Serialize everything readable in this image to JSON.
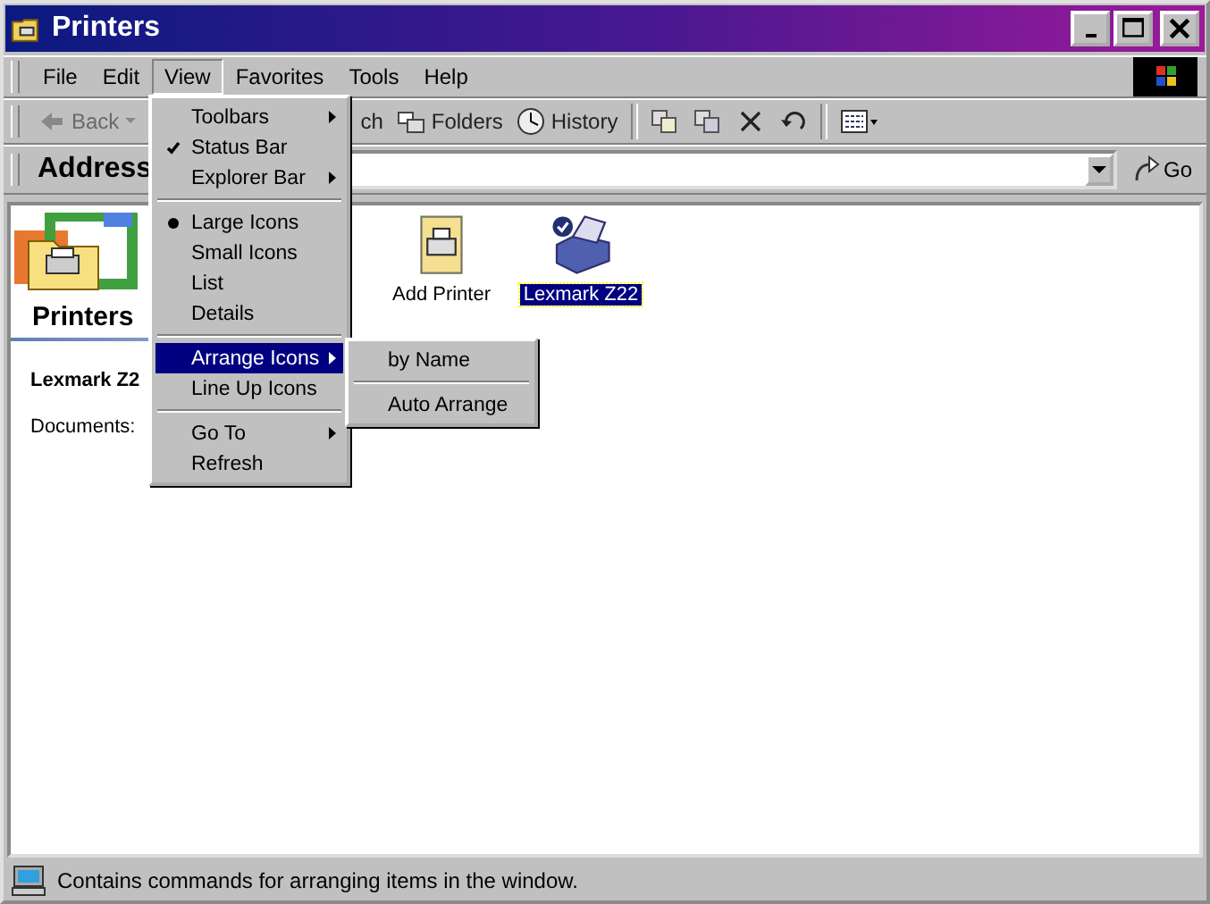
{
  "window": {
    "title": "Printers"
  },
  "menu_bar": [
    {
      "label": "File",
      "selected": false
    },
    {
      "label": "Edit",
      "selected": false
    },
    {
      "label": "View",
      "selected": true
    },
    {
      "label": "Favorites",
      "selected": false
    },
    {
      "label": "Tools",
      "selected": false
    },
    {
      "label": "Help",
      "selected": false
    }
  ],
  "toolbar": [
    {
      "kind": "back",
      "label": "Back",
      "disabled": true
    },
    {
      "kind": "search",
      "label": "ch",
      "disabled": false
    },
    {
      "kind": "folders",
      "label": "Folders",
      "disabled": false
    },
    {
      "kind": "history",
      "label": "History",
      "disabled": false
    },
    {
      "kind": "separator"
    },
    {
      "kind": "move",
      "disabled": false
    },
    {
      "kind": "copy",
      "disabled": false
    },
    {
      "kind": "delete",
      "disabled": false
    },
    {
      "kind": "undo",
      "disabled": false
    },
    {
      "kind": "separator"
    },
    {
      "kind": "views",
      "disabled": false
    }
  ],
  "address_bar": {
    "label": "Address",
    "go": "Go"
  },
  "info_panel": {
    "title": "Printers",
    "selected_name": "Lexmark Z2",
    "documents": "Documents: "
  },
  "icons": [
    {
      "kind": "add-printer",
      "label": "Add Printer",
      "selected": false
    },
    {
      "kind": "printer",
      "label": "Lexmark Z22",
      "selected": true
    }
  ],
  "view_menu": [
    {
      "kind": "command",
      "label": "Toolbars",
      "submenu": true,
      "selected": false
    },
    {
      "kind": "check",
      "label": "Status Bar",
      "checked": true,
      "submenu": false,
      "selected": false
    },
    {
      "kind": "command",
      "label": "Explorer Bar",
      "submenu": true,
      "selected": false
    },
    {
      "kind": "separator"
    },
    {
      "kind": "radio",
      "label": "Large Icons",
      "checked": true,
      "submenu": false,
      "selected": false
    },
    {
      "kind": "radio",
      "label": "Small Icons",
      "checked": false,
      "submenu": false,
      "selected": false
    },
    {
      "kind": "radio",
      "label": "List",
      "checked": false,
      "submenu": false,
      "selected": false
    },
    {
      "kind": "radio",
      "label": "Details",
      "checked": false,
      "submenu": false,
      "selected": false
    },
    {
      "kind": "separator"
    },
    {
      "kind": "command",
      "label": "Arrange Icons",
      "submenu": true,
      "selected": true
    },
    {
      "kind": "command",
      "label": "Line Up Icons",
      "submenu": false,
      "selected": false
    },
    {
      "kind": "separator"
    },
    {
      "kind": "command",
      "label": "Go To",
      "submenu": true,
      "selected": false
    },
    {
      "kind": "command",
      "label": "Refresh",
      "submenu": false,
      "selected": false
    }
  ],
  "arrange_submenu": [
    {
      "kind": "command",
      "label": "by Name",
      "selected": false
    },
    {
      "kind": "separator"
    },
    {
      "kind": "command",
      "label": "Auto Arrange",
      "selected": false
    }
  ],
  "status_bar": {
    "text": "Contains commands for arranging items in the window."
  }
}
